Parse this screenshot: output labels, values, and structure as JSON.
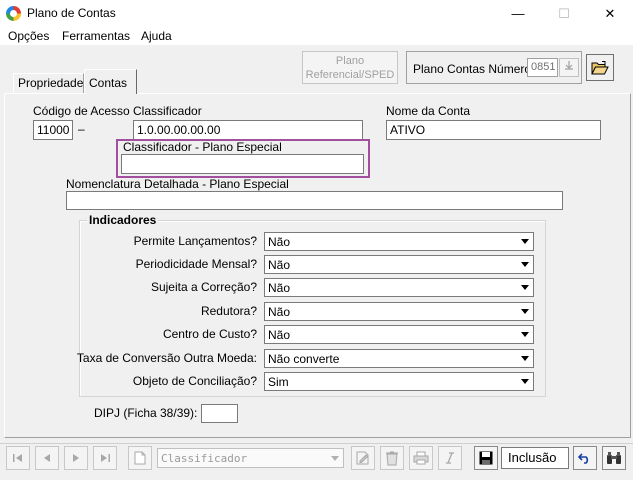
{
  "window": {
    "title": "Plano de Contas",
    "min": "—",
    "max": "☐",
    "close": "✕"
  },
  "menu": [
    "Opções",
    "Ferramentas",
    "Ajuda"
  ],
  "tabs": [
    "Propriedades",
    "Contas"
  ],
  "header": {
    "plano_referencial_line1": "Plano",
    "plano_referencial_line2": "Referencial/SPED",
    "plano_contas_numero_label": "Plano Contas Número",
    "plano_contas_numero_value": "0851"
  },
  "form": {
    "codigo_acesso_label": "Código de Acesso",
    "codigo_acesso_value": "11000",
    "dash": "–",
    "classificador_label": "Classificador",
    "classificador_value": "1.0.00.00.00.00",
    "nome_conta_label": "Nome da Conta",
    "nome_conta_value": "ATIVO",
    "classificador_especial_label": "Classificador  - Plano Especial",
    "classificador_especial_value": "",
    "nomenclatura_label": "Nomenclatura Detalhada - Plano Especial",
    "nomenclatura_value": ""
  },
  "indicadores": {
    "title": "Indicadores",
    "rows": [
      {
        "label": "Permite Lançamentos?",
        "value": "Não"
      },
      {
        "label": "Periodicidade Mensal?",
        "value": "Não"
      },
      {
        "label": "Sujeita a Correção?",
        "value": "Não"
      },
      {
        "label": "Redutora?",
        "value": "Não"
      },
      {
        "label": "Centro de Custo?",
        "value": "Não"
      },
      {
        "label": "Taxa de Conversão Outra Moeda:",
        "value": "Não converte"
      },
      {
        "label": "Objeto de Conciliação?",
        "value": "Sim"
      }
    ]
  },
  "dipj": {
    "label": "DIPJ (Ficha 38/39):",
    "value": ""
  },
  "toolbar": {
    "search_combo_value": "Classificador",
    "status": "Inclusão"
  }
}
